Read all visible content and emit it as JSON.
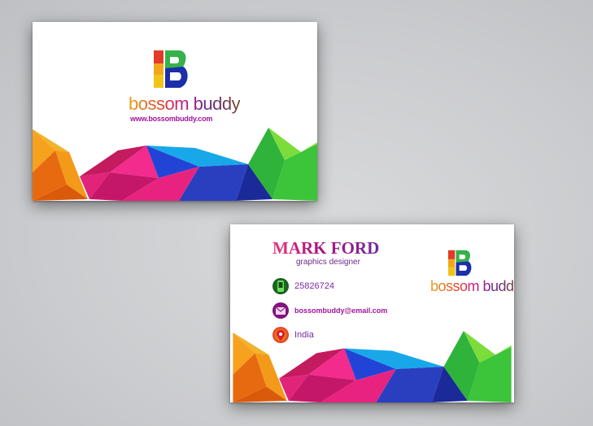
{
  "brand": {
    "name": "bossom buddy",
    "website": "www.bossombuddy.com",
    "logo_letter": "B"
  },
  "person": {
    "name": "MARK FORD",
    "title": "graphics designer"
  },
  "contacts": {
    "phone": "25826724",
    "email": "bossombuddy@email.com",
    "location": "India"
  },
  "icons": {
    "phone": "phone-icon",
    "email": "envelope-icon",
    "location": "map-pin-icon"
  },
  "colors": {
    "orange": "#f28a1a",
    "pink": "#e8237f",
    "blue": "#1d3fc4",
    "cyan": "#19a9e8",
    "green": "#3cc43a",
    "purple": "#6e2a99"
  }
}
